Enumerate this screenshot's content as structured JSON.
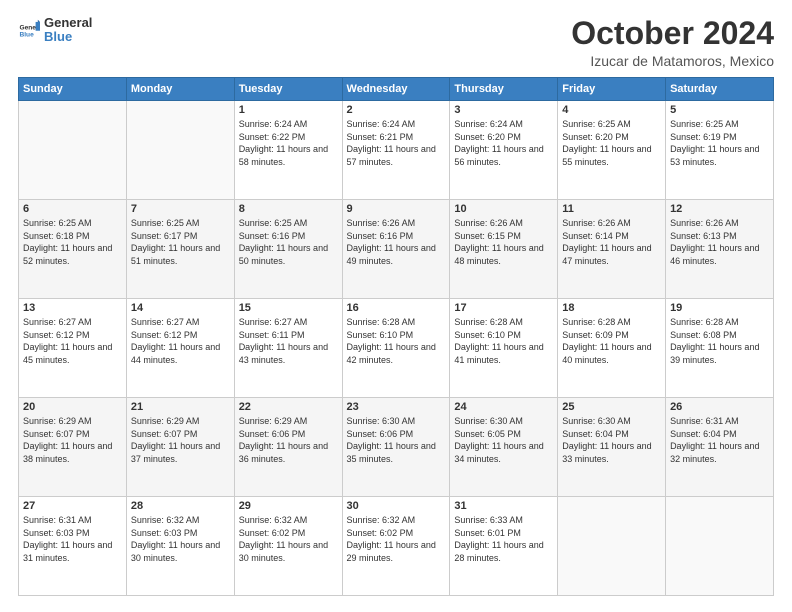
{
  "logo": {
    "general": "General",
    "blue": "Blue"
  },
  "header": {
    "month": "October 2024",
    "location": "Izucar de Matamoros, Mexico"
  },
  "weekdays": [
    "Sunday",
    "Monday",
    "Tuesday",
    "Wednesday",
    "Thursday",
    "Friday",
    "Saturday"
  ],
  "weeks": [
    [
      {
        "day": "",
        "info": ""
      },
      {
        "day": "",
        "info": ""
      },
      {
        "day": "1",
        "sunrise": "6:24 AM",
        "sunset": "6:22 PM",
        "daylight": "11 hours and 58 minutes."
      },
      {
        "day": "2",
        "sunrise": "6:24 AM",
        "sunset": "6:21 PM",
        "daylight": "11 hours and 57 minutes."
      },
      {
        "day": "3",
        "sunrise": "6:24 AM",
        "sunset": "6:20 PM",
        "daylight": "11 hours and 56 minutes."
      },
      {
        "day": "4",
        "sunrise": "6:25 AM",
        "sunset": "6:20 PM",
        "daylight": "11 hours and 55 minutes."
      },
      {
        "day": "5",
        "sunrise": "6:25 AM",
        "sunset": "6:19 PM",
        "daylight": "11 hours and 53 minutes."
      }
    ],
    [
      {
        "day": "6",
        "sunrise": "6:25 AM",
        "sunset": "6:18 PM",
        "daylight": "11 hours and 52 minutes."
      },
      {
        "day": "7",
        "sunrise": "6:25 AM",
        "sunset": "6:17 PM",
        "daylight": "11 hours and 51 minutes."
      },
      {
        "day": "8",
        "sunrise": "6:25 AM",
        "sunset": "6:16 PM",
        "daylight": "11 hours and 50 minutes."
      },
      {
        "day": "9",
        "sunrise": "6:26 AM",
        "sunset": "6:16 PM",
        "daylight": "11 hours and 49 minutes."
      },
      {
        "day": "10",
        "sunrise": "6:26 AM",
        "sunset": "6:15 PM",
        "daylight": "11 hours and 48 minutes."
      },
      {
        "day": "11",
        "sunrise": "6:26 AM",
        "sunset": "6:14 PM",
        "daylight": "11 hours and 47 minutes."
      },
      {
        "day": "12",
        "sunrise": "6:26 AM",
        "sunset": "6:13 PM",
        "daylight": "11 hours and 46 minutes."
      }
    ],
    [
      {
        "day": "13",
        "sunrise": "6:27 AM",
        "sunset": "6:12 PM",
        "daylight": "11 hours and 45 minutes."
      },
      {
        "day": "14",
        "sunrise": "6:27 AM",
        "sunset": "6:12 PM",
        "daylight": "11 hours and 44 minutes."
      },
      {
        "day": "15",
        "sunrise": "6:27 AM",
        "sunset": "6:11 PM",
        "daylight": "11 hours and 43 minutes."
      },
      {
        "day": "16",
        "sunrise": "6:28 AM",
        "sunset": "6:10 PM",
        "daylight": "11 hours and 42 minutes."
      },
      {
        "day": "17",
        "sunrise": "6:28 AM",
        "sunset": "6:10 PM",
        "daylight": "11 hours and 41 minutes."
      },
      {
        "day": "18",
        "sunrise": "6:28 AM",
        "sunset": "6:09 PM",
        "daylight": "11 hours and 40 minutes."
      },
      {
        "day": "19",
        "sunrise": "6:28 AM",
        "sunset": "6:08 PM",
        "daylight": "11 hours and 39 minutes."
      }
    ],
    [
      {
        "day": "20",
        "sunrise": "6:29 AM",
        "sunset": "6:07 PM",
        "daylight": "11 hours and 38 minutes."
      },
      {
        "day": "21",
        "sunrise": "6:29 AM",
        "sunset": "6:07 PM",
        "daylight": "11 hours and 37 minutes."
      },
      {
        "day": "22",
        "sunrise": "6:29 AM",
        "sunset": "6:06 PM",
        "daylight": "11 hours and 36 minutes."
      },
      {
        "day": "23",
        "sunrise": "6:30 AM",
        "sunset": "6:06 PM",
        "daylight": "11 hours and 35 minutes."
      },
      {
        "day": "24",
        "sunrise": "6:30 AM",
        "sunset": "6:05 PM",
        "daylight": "11 hours and 34 minutes."
      },
      {
        "day": "25",
        "sunrise": "6:30 AM",
        "sunset": "6:04 PM",
        "daylight": "11 hours and 33 minutes."
      },
      {
        "day": "26",
        "sunrise": "6:31 AM",
        "sunset": "6:04 PM",
        "daylight": "11 hours and 32 minutes."
      }
    ],
    [
      {
        "day": "27",
        "sunrise": "6:31 AM",
        "sunset": "6:03 PM",
        "daylight": "11 hours and 31 minutes."
      },
      {
        "day": "28",
        "sunrise": "6:32 AM",
        "sunset": "6:03 PM",
        "daylight": "11 hours and 30 minutes."
      },
      {
        "day": "29",
        "sunrise": "6:32 AM",
        "sunset": "6:02 PM",
        "daylight": "11 hours and 30 minutes."
      },
      {
        "day": "30",
        "sunrise": "6:32 AM",
        "sunset": "6:02 PM",
        "daylight": "11 hours and 29 minutes."
      },
      {
        "day": "31",
        "sunrise": "6:33 AM",
        "sunset": "6:01 PM",
        "daylight": "11 hours and 28 minutes."
      },
      {
        "day": "",
        "info": ""
      },
      {
        "day": "",
        "info": ""
      }
    ]
  ]
}
